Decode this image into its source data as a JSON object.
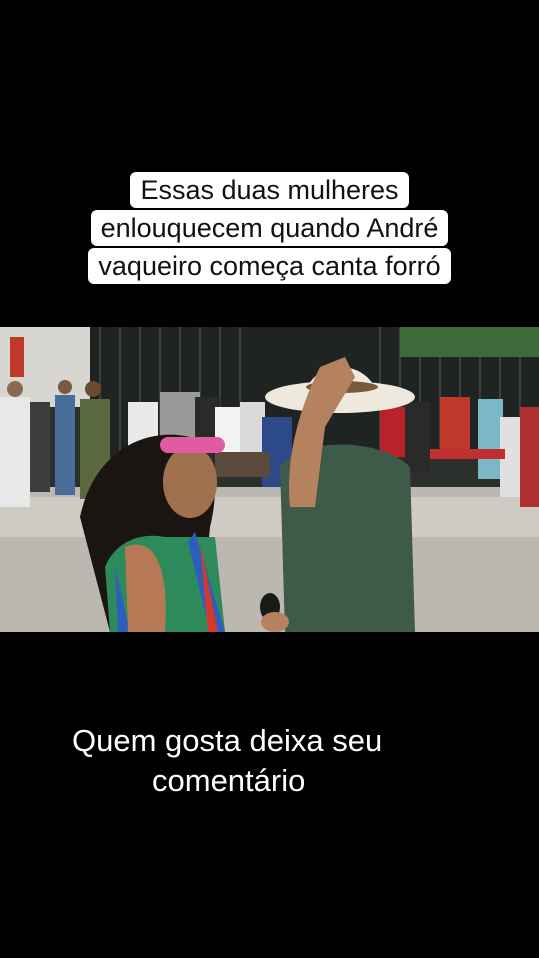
{
  "caption": {
    "lines": [
      "Essas duas mulheres",
      "enlouquecem quando André",
      "vaqueiro começa canta forró"
    ]
  },
  "photo": {
    "description_icon": "video-frame",
    "colors": {
      "building": "#2a2e2b",
      "street": "#bdb9b2",
      "shirt": "#3e5a48",
      "hat": "#efe9dd",
      "glasses": "#e25aa0"
    }
  },
  "bottom": {
    "line1": "Quem gosta deixa seu",
    "line2": "comentário"
  }
}
